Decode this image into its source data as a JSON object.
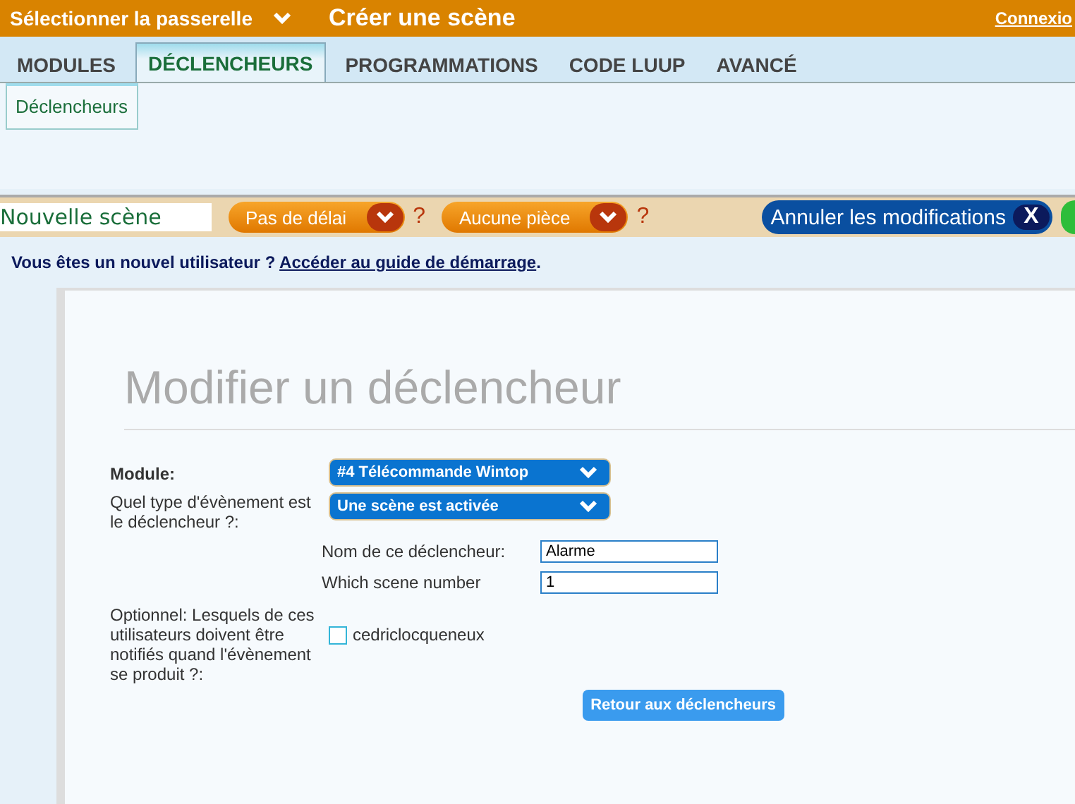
{
  "header": {
    "gateway": "Sélectionner la passerelle",
    "title": "Créer une scène",
    "login": "Connexio"
  },
  "tabs": [
    {
      "label": "MODULES",
      "selected": false
    },
    {
      "label": "DÉCLENCHEURS",
      "selected": true
    },
    {
      "label": "PROGRAMMATIONS",
      "selected": false
    },
    {
      "label": "CODE LUUP",
      "selected": false
    },
    {
      "label": "AVANCÉ",
      "selected": false
    }
  ],
  "subtabs": [
    {
      "label": "Déclencheurs",
      "selected": true
    }
  ],
  "toolbar": {
    "scene_name": "Nouvelle scène",
    "delay": "Pas de délai",
    "delay_help": "?",
    "room": "Aucune pièce",
    "room_help": "?",
    "cancel": "Annuler les modifications",
    "cancel_key": "X"
  },
  "notice": {
    "text": "Vous êtes un nouvel utilisateur ?",
    "link": "Accéder au guide de démarrage",
    "end": "."
  },
  "panel": {
    "title": "Modifier un déclencheur",
    "module_label": "Module:",
    "module_value": "#4 Télécommande Wintop",
    "event_label": "Quel type d'évènement est le déclencheur ?:",
    "event_value": "Une scène est activée",
    "fields": [
      {
        "label": "Nom de ce déclencheur:",
        "value": "Alarme"
      },
      {
        "label": "Which scene number",
        "value": "1"
      }
    ],
    "notify_label": "Optionnel: Lesquels de ces utilisateurs doivent être notifiés quand l'évènement se produit ?:",
    "users": [
      {
        "name": "cedriclocqueneux",
        "checked": false
      }
    ],
    "back": "Retour aux déclencheurs"
  }
}
